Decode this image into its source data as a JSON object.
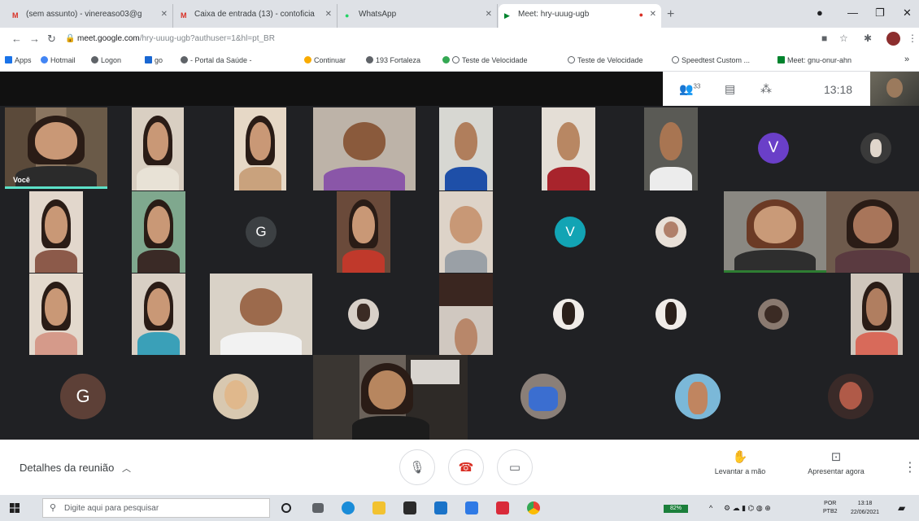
{
  "browser": {
    "tabs": [
      {
        "title": "(sem assunto) - vinereaso03@g",
        "icon": "gmail-icon",
        "active": false
      },
      {
        "title": "Caixa de entrada (13) - contoficia",
        "icon": "gmail-icon",
        "active": false
      },
      {
        "title": "WhatsApp",
        "icon": "whatsapp-icon",
        "active": false
      },
      {
        "title": "Meet: hry-uuug-ugb",
        "icon": "meet-icon",
        "active": true
      }
    ],
    "url_host": "meet.google.com",
    "url_path": "/hry-uuug-ugb?authuser=1&hl=pt_BR",
    "bookmarks": [
      "Apps",
      "Hotmail",
      "Logon",
      "go",
      "- Portal da Saúde -",
      "Continuar",
      "193 Fortaleza",
      "Teste de Velocidade",
      "Teste de Velocidade",
      "Speedtest Custom ...",
      "Meet: gnu-onur-ahn"
    ]
  },
  "meet": {
    "participants_count": "33",
    "time": "13:18",
    "self_label": "Você",
    "avatars": [
      {
        "letter": "V",
        "color": "#6a3fc8"
      },
      {
        "letter": "G",
        "color": "#3c4043"
      },
      {
        "letter": "V",
        "color": "#12a4b4"
      },
      {
        "letter": "G",
        "color": "#5d4037"
      }
    ],
    "controls": {
      "details_label": "Detalhes da reunião",
      "raise_hand_label": "Levantar a mão",
      "present_label": "Apresentar agora"
    }
  },
  "taskbar": {
    "search_placeholder": "Digite aqui para pesquisar",
    "battery": "82%",
    "lang_top": "POR",
    "lang_bottom": "PTB2",
    "clock_time": "13:18",
    "clock_date": "22/06/2021"
  },
  "colors": {
    "meet_bg": "#202124",
    "active_speaker": "#5ce1c8",
    "end_call": "#d93025"
  }
}
